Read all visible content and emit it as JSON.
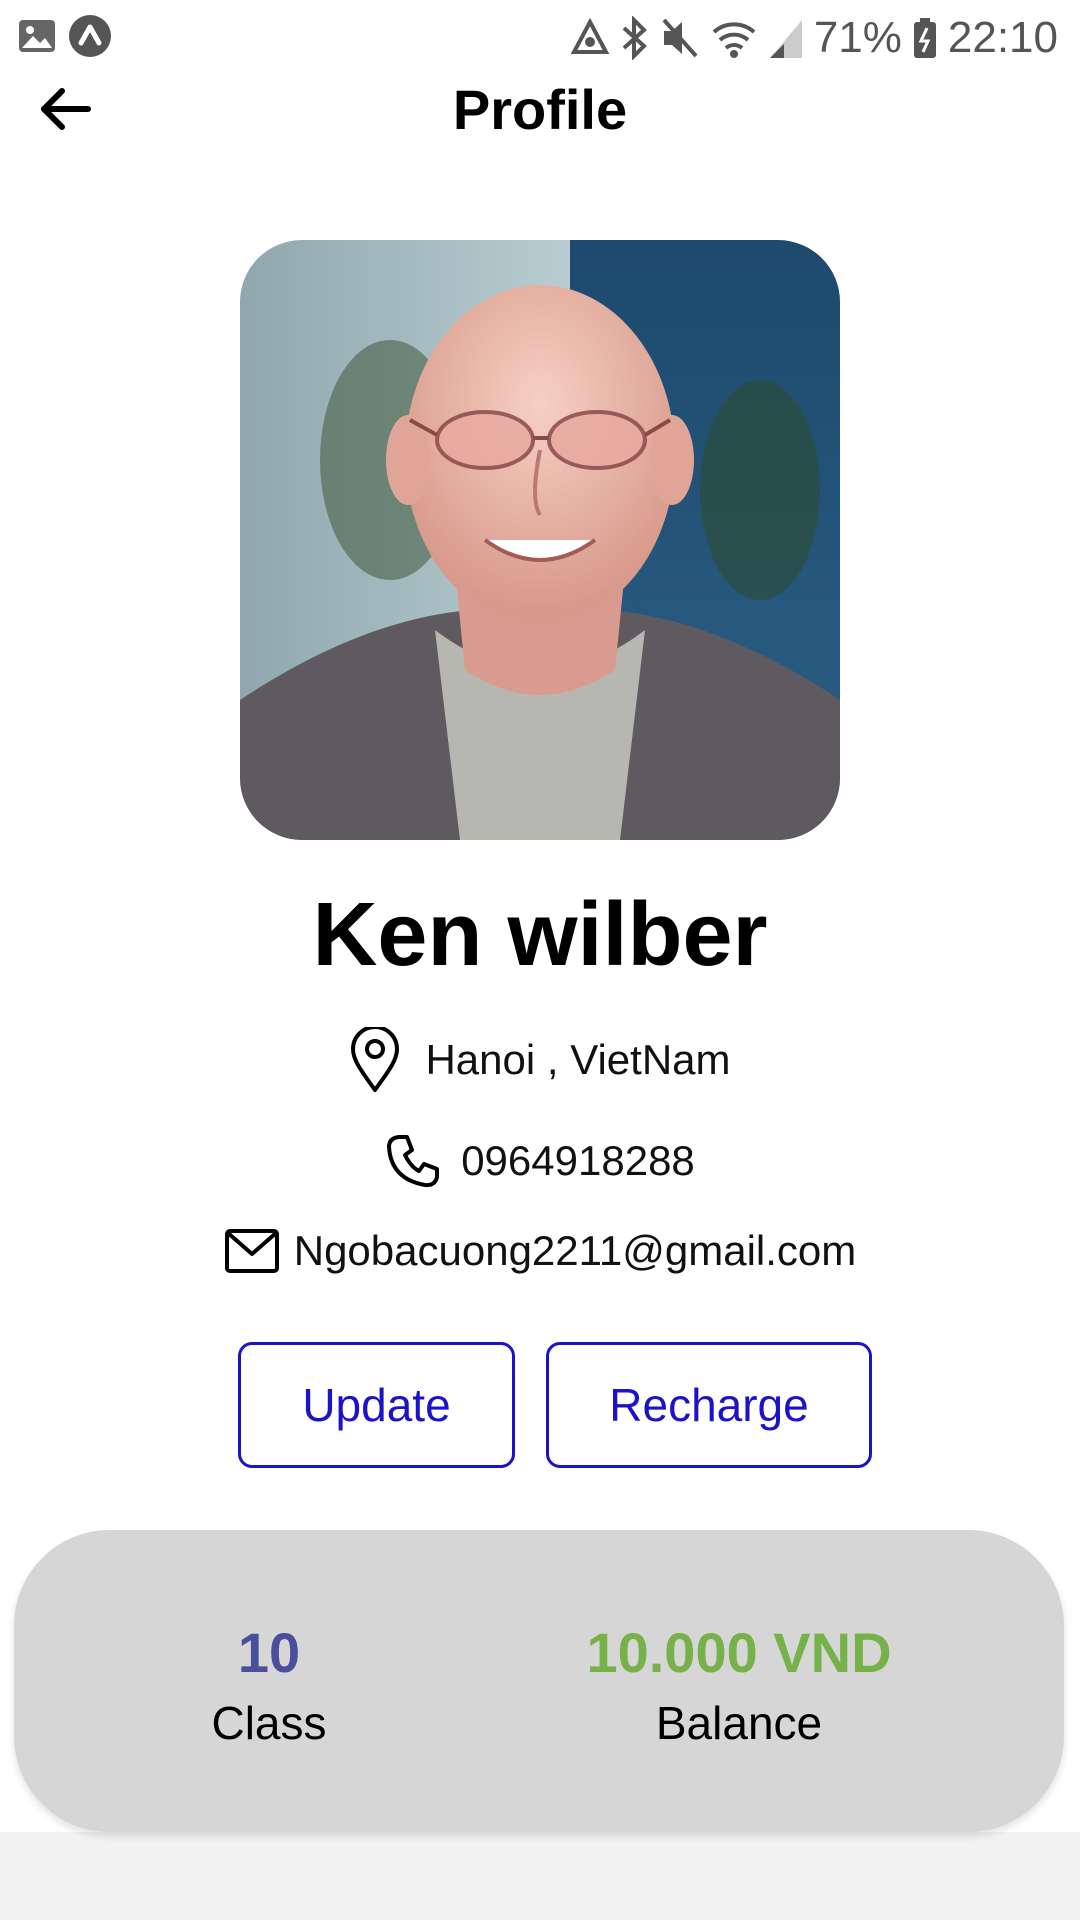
{
  "status_bar": {
    "battery": "71%",
    "time": "22:10"
  },
  "header": {
    "title": "Profile"
  },
  "profile": {
    "name": "Ken wilber",
    "location": "Hanoi , VietNam",
    "phone": "0964918288",
    "email": "Ngobacuong2211@gmail.com"
  },
  "actions": {
    "update_label": "Update",
    "recharge_label": "Recharge"
  },
  "stats": {
    "class_value": "10",
    "class_label": "Class",
    "balance_value": "10.000 VND",
    "balance_label": "Balance"
  },
  "colors": {
    "button_accent": "#1b13c8",
    "class_value": "#4a4f9c",
    "balance_value": "#77b14a",
    "card_background": "#d6d6d6"
  }
}
